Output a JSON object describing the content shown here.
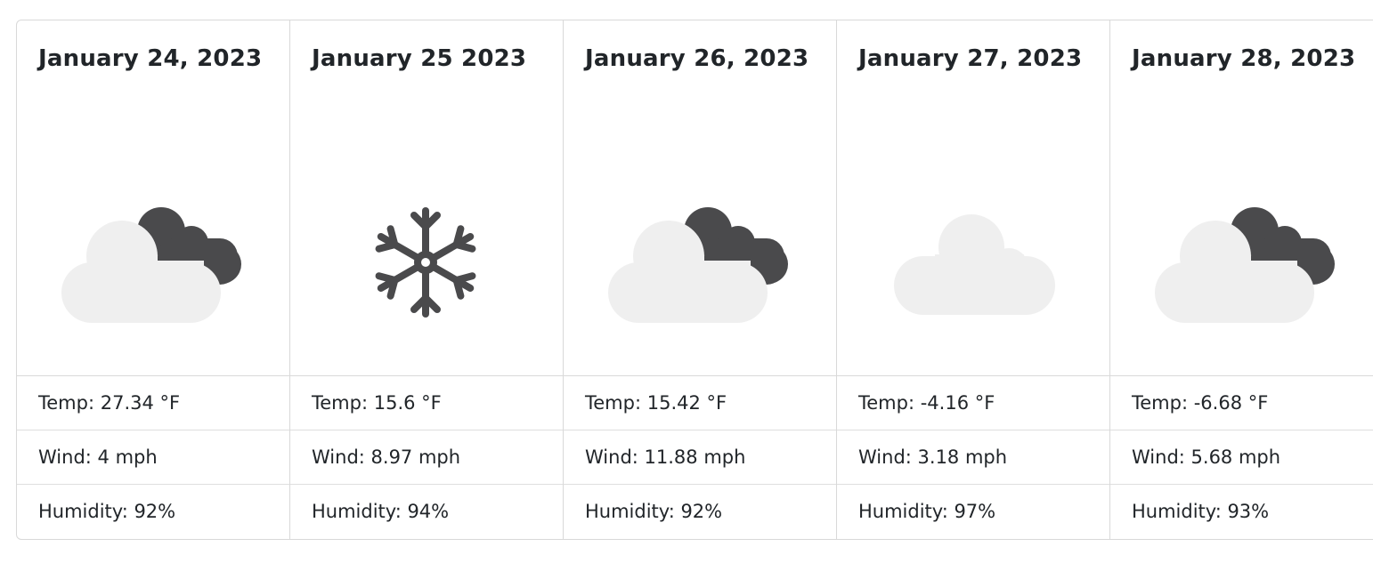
{
  "forecast": {
    "days": [
      {
        "date": "January 24, 2023",
        "icon": "partly-cloudy-night-icon",
        "temp": "Temp: 27.34 °F",
        "wind": "Wind: 4 mph",
        "humidity": "Humidity: 92%"
      },
      {
        "date": "January 25 2023",
        "icon": "snowflake-icon",
        "temp": "Temp: 15.6 °F",
        "wind": "Wind: 8.97 mph",
        "humidity": "Humidity: 94%"
      },
      {
        "date": "January 26, 2023",
        "icon": "partly-cloudy-night-icon",
        "temp": "Temp: 15.42 °F",
        "wind": "Wind: 11.88 mph",
        "humidity": "Humidity: 92%"
      },
      {
        "date": "January 27, 2023",
        "icon": "cloud-icon",
        "temp": "Temp: -4.16 °F",
        "wind": "Wind: 3.18 mph",
        "humidity": "Humidity: 97%"
      },
      {
        "date": "January 28, 2023",
        "icon": "partly-cloudy-night-icon",
        "temp": "Temp: -6.68 °F",
        "wind": "Wind: 5.68 mph",
        "humidity": "Humidity: 93%"
      }
    ]
  },
  "colors": {
    "light_cloud": "#efefef",
    "dark_cloud": "#4a4a4c",
    "border": "#d9d9d9",
    "text": "#212529"
  }
}
